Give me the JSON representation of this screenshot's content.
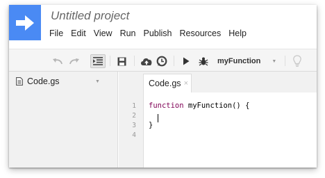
{
  "header": {
    "title": "Untitled project",
    "menu": [
      "File",
      "Edit",
      "View",
      "Run",
      "Publish",
      "Resources",
      "Help"
    ]
  },
  "toolbar": {
    "function_name": "myFunction",
    "icons": [
      "undo-icon",
      "redo-icon",
      "indent-icon",
      "save-icon",
      "cloud-upload-icon",
      "clock-trigger-icon",
      "run-icon",
      "debug-icon",
      "lightbulb-icon"
    ]
  },
  "sidebar": {
    "files": [
      {
        "name": "Code.gs"
      }
    ]
  },
  "editor": {
    "tab_label": "Code.gs",
    "tab_close": "×",
    "line_numbers": [
      "1",
      "2",
      "3",
      "4"
    ],
    "code": {
      "line1_keyword": "function",
      "line1_rest": " myFunction() {",
      "line3": "}"
    }
  },
  "colors": {
    "logo_blue": "#4a8af4",
    "keyword": "#7f0055"
  }
}
